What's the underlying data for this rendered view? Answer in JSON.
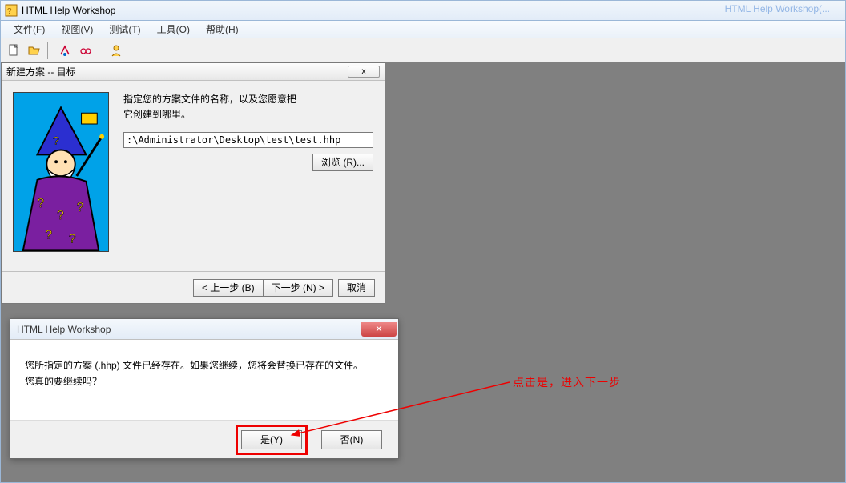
{
  "app": {
    "title": "HTML Help Workshop",
    "taskbar_hint": "HTML Help Workshop(..."
  },
  "menubar": {
    "file": "文件(F)",
    "view": "视图(V)",
    "test": "测试(T)",
    "tools": "工具(O)",
    "help": "帮助(H)"
  },
  "toolbar": {
    "new": "new",
    "open": "open",
    "compile": "compile",
    "view_compiled": "view",
    "help_author": "help-author"
  },
  "wizard": {
    "title": "新建方案 -- 目标",
    "description_line1": "指定您的方案文件的名称，以及您愿意把",
    "description_line2": "它创建到哪里。",
    "path_value": ":\\Administrator\\Desktop\\test\\test.hhp",
    "browse_label": "浏览 (R)...",
    "prev_label": "< 上一步 (B)",
    "next_label": "下一步 (N) >",
    "cancel_label": "取消",
    "close_glyph": "x"
  },
  "msgbox": {
    "title": "HTML Help Workshop",
    "body_line1": "您所指定的方案 (.hhp) 文件已经存在。如果您继续，您将会替换已存在的文件。",
    "body_line2": "您真的要继续吗？",
    "yes_label": "是(Y)",
    "no_label": "否(N)",
    "close_glyph": "✕"
  },
  "annotation": {
    "text": "点击是，进入下一步"
  }
}
